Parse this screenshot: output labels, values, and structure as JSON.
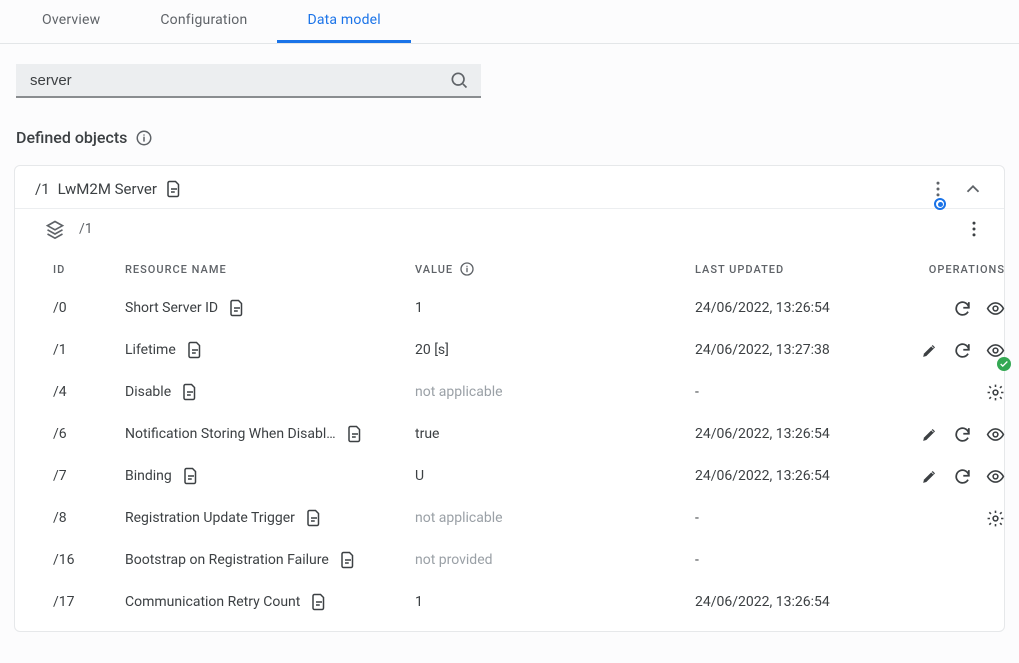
{
  "tabs": [
    {
      "label": "Overview",
      "active": false
    },
    {
      "label": "Configuration",
      "active": false
    },
    {
      "label": "Data model",
      "active": true
    }
  ],
  "search": {
    "value": "server"
  },
  "section": {
    "title": "Defined objects"
  },
  "object": {
    "path": "/1",
    "name": "LwM2M Server",
    "instance": "/1"
  },
  "columns": {
    "id": "ID",
    "resource": "RESOURCE NAME",
    "value": "VALUE",
    "updated": "LAST UPDATED",
    "ops": "OPERATIONS"
  },
  "rows": [
    {
      "id": "/0",
      "name": "Short Server ID",
      "value": "1",
      "updated": "24/06/2022, 13:26:54",
      "ops": [
        "refresh",
        "eye"
      ]
    },
    {
      "id": "/1",
      "name": "Lifetime",
      "value": "20 [s]",
      "updated": "24/06/2022, 13:27:38",
      "ops": [
        "edit",
        "refresh",
        "eye"
      ],
      "ok": true
    },
    {
      "id": "/4",
      "name": "Disable",
      "value": "not applicable",
      "dim": true,
      "updated": "-",
      "ops": [
        "gear"
      ]
    },
    {
      "id": "/6",
      "name": "Notification Storing When Disabl…",
      "value": "true",
      "updated": "24/06/2022, 13:26:54",
      "ops": [
        "edit",
        "refresh",
        "eye"
      ]
    },
    {
      "id": "/7",
      "name": "Binding",
      "value": "U",
      "updated": "24/06/2022, 13:26:54",
      "ops": [
        "edit",
        "refresh",
        "eye"
      ]
    },
    {
      "id": "/8",
      "name": "Registration Update Trigger",
      "value": "not applicable",
      "dim": true,
      "updated": "-",
      "ops": [
        "gear"
      ]
    },
    {
      "id": "/16",
      "name": "Bootstrap on Registration Failure",
      "value": "not provided",
      "dim": true,
      "updated": "-",
      "ops": []
    },
    {
      "id": "/17",
      "name": "Communication Retry Count",
      "value": "1",
      "updated": "24/06/2022, 13:26:54",
      "ops": []
    }
  ]
}
